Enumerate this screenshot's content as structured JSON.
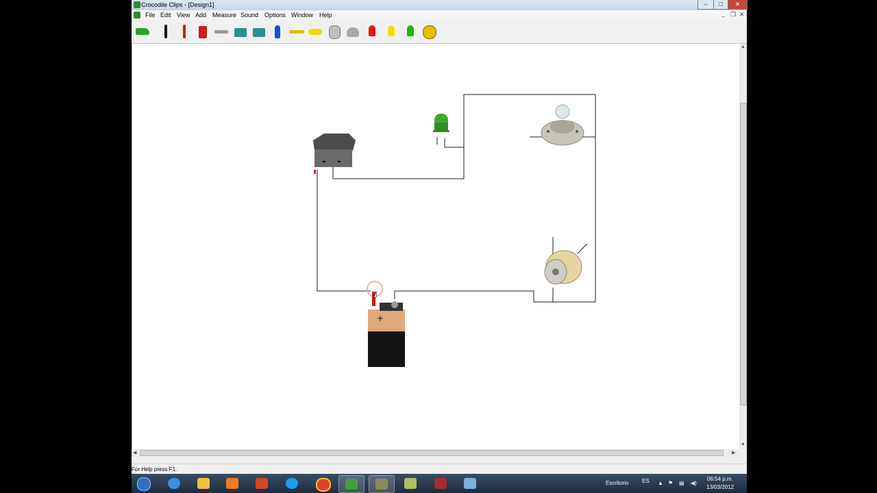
{
  "window": {
    "title": "Crocodile Clips - [Design1]",
    "controls": {
      "minimize": "–",
      "maximize": "□",
      "close": "✕"
    },
    "mdi_controls": {
      "minimize": "_",
      "restore": "❐",
      "close": "✕"
    }
  },
  "menu": {
    "items": [
      "File",
      "Edit",
      "View",
      "Add",
      "Measure",
      "Sound",
      "Options",
      "Window",
      "Help"
    ]
  },
  "toolbar": {
    "tools": [
      {
        "icon": "crocodile-icon",
        "color": "#2f9e2f"
      },
      {
        "icon": "black-probe-icon",
        "color": "#111111"
      },
      {
        "icon": "red-probe-icon",
        "color": "#d01818"
      },
      {
        "icon": "battery-icon",
        "color": "#c81e1e"
      },
      {
        "icon": "resistor-icon",
        "color": "#9a9a9a"
      },
      {
        "icon": "switch-icon",
        "color": "#2f8f8f"
      },
      {
        "icon": "switch-alt-icon",
        "color": "#2f8f8f"
      },
      {
        "icon": "push-switch-icon",
        "color": "#1f4fbf"
      },
      {
        "icon": "fuse-icon",
        "color": "#e0c000"
      },
      {
        "icon": "buzzer-icon",
        "color": "#f0d800"
      },
      {
        "icon": "motor-icon",
        "color": "#c0c0c0"
      },
      {
        "icon": "lamp-icon",
        "color": "#a8a8a8"
      },
      {
        "icon": "red-led-icon",
        "color": "#e01818"
      },
      {
        "icon": "yellow-led-icon",
        "color": "#f0e000"
      },
      {
        "icon": "green-led-icon",
        "color": "#20b020"
      },
      {
        "icon": "probe-meter-icon",
        "color": "#e0c000"
      }
    ]
  },
  "circuit": {
    "battery_symbol": "+",
    "components": [
      "switch",
      "green-led",
      "lamp",
      "motor",
      "battery"
    ]
  },
  "status": {
    "text": "For Help press F1."
  },
  "taskbar": {
    "apps": [
      {
        "icon": "ie-icon",
        "color": "#3b8fe0"
      },
      {
        "icon": "folder-icon",
        "color": "#f0c040"
      },
      {
        "icon": "media-player-icon",
        "color": "#f07a20"
      },
      {
        "icon": "powerpoint-icon",
        "color": "#d24726"
      },
      {
        "icon": "skype-icon",
        "color": "#1aa0e8"
      },
      {
        "icon": "chrome-icon",
        "color": "#e0412e"
      },
      {
        "icon": "crocodile-clips-icon",
        "color": "#3fa33f"
      },
      {
        "icon": "network-icon",
        "color": "#8a8a5a"
      },
      {
        "icon": "notes-icon",
        "color": "#b0c060"
      },
      {
        "icon": "film-icon",
        "color": "#a03030"
      },
      {
        "icon": "window-icon",
        "color": "#7ab0e0"
      }
    ],
    "desktop_label": "Escritorio",
    "language": "ES",
    "clock_time": "06:54 p.m.",
    "clock_date": "13/03/2012"
  }
}
